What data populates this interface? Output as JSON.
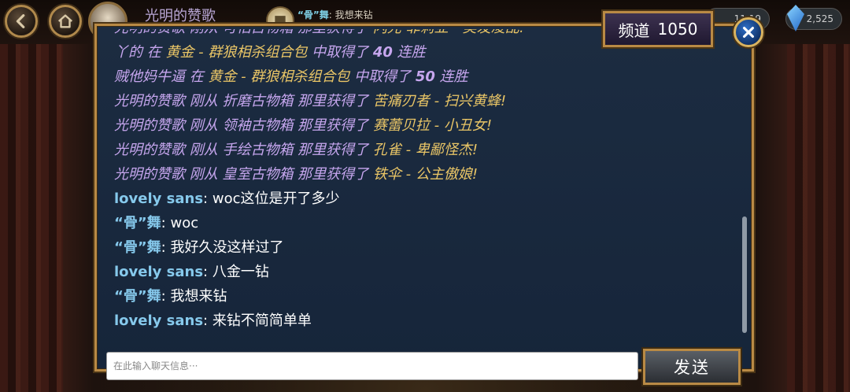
{
  "topbar": {
    "player_name": "光明的赞歌",
    "ticker_user": "“骨”舞",
    "ticker_text": ": 我想来钻",
    "gold_amount": "11,19",
    "gem_amount": "2,525"
  },
  "dialog": {
    "channel_label": "频道",
    "channel_number": "1050",
    "messages": [
      {
        "kind": "sys",
        "parts": [
          "光明的赞歌 刚从 ",
          "可怕古物箱",
          " 那里获得了 ",
          "闪光 菲莉亚 - 美发凌乱!"
        ]
      },
      {
        "kind": "sys2",
        "parts": [
          "丫的 在 ",
          "黄金 - 群狼相杀组合包",
          " 中取得了 ",
          "40",
          " 连胜"
        ]
      },
      {
        "kind": "sys2",
        "parts": [
          "贼他妈牛逼 在 ",
          "黄金 - 群狼相杀组合包",
          " 中取得了 ",
          "50",
          " 连胜"
        ]
      },
      {
        "kind": "sys",
        "parts": [
          "光明的赞歌 刚从 ",
          "折磨古物箱",
          " 那里获得了 ",
          "苦痛刃者 - 扫兴黄蜂!"
        ]
      },
      {
        "kind": "sys",
        "parts": [
          "光明的赞歌 刚从 ",
          "领袖古物箱",
          " 那里获得了 ",
          "赛蕾贝拉 - 小丑女!"
        ]
      },
      {
        "kind": "sys",
        "parts": [
          "光明的赞歌 刚从 ",
          "手绘古物箱",
          " 那里获得了 ",
          "孔雀 - 卑鄙怪杰!"
        ]
      },
      {
        "kind": "sys",
        "parts": [
          "光明的赞歌 刚从 ",
          "皇室古物箱",
          " 那里获得了 ",
          "铁伞 - 公主傲娘!"
        ]
      },
      {
        "kind": "chat",
        "user": "lovely sans",
        "text": "woc这位是开了多少"
      },
      {
        "kind": "chat",
        "user": "“骨”舞",
        "text": "woc"
      },
      {
        "kind": "chat",
        "user": "“骨”舞",
        "text": "我好久没这样过了"
      },
      {
        "kind": "chat",
        "user": "lovely sans",
        "text": "八金一钻"
      },
      {
        "kind": "chat",
        "user": "“骨”舞",
        "text": "我想来钻"
      },
      {
        "kind": "chat",
        "user": "lovely sans",
        "text": "来钻不简简单单"
      }
    ],
    "input_placeholder": "在此输入聊天信息···",
    "send_label": "发送"
  },
  "icons": [
    "back-icon",
    "home-icon",
    "chat-bubble-icon",
    "gem-icon",
    "close-icon"
  ],
  "colors": {
    "system_text": "#c6a6ee",
    "item_highlight": "#e9c566",
    "username": "#86c9ec",
    "frame_gold": "#b98a45",
    "panel_bg": "#1c2c41"
  }
}
